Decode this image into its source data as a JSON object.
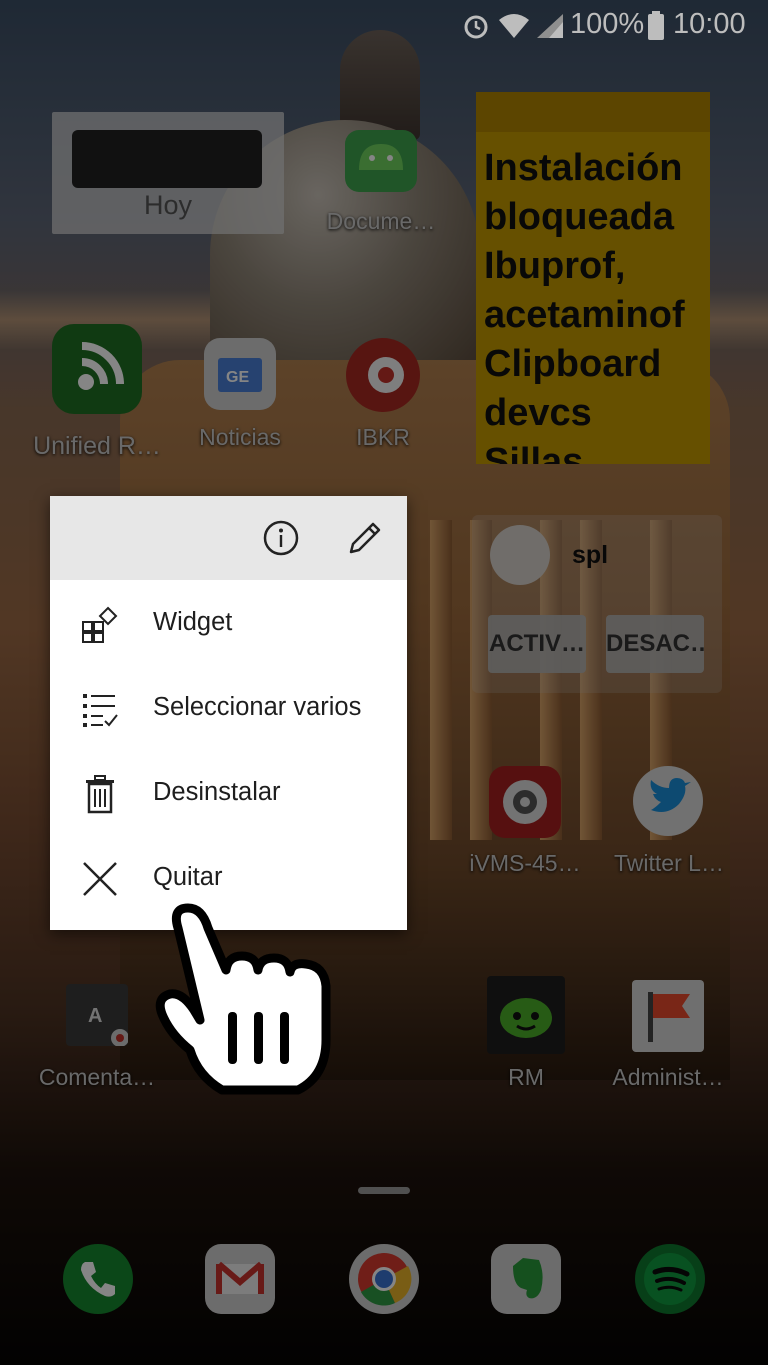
{
  "status_bar": {
    "battery_percent": "100%",
    "time": "10:00",
    "icons": [
      "alarm-icon",
      "wifi-icon",
      "signal-icon",
      "battery-icon"
    ]
  },
  "home": {
    "hoy_widget": {
      "label": "Hoy"
    },
    "sticky_note": {
      "text": "Instalación\nbloqueada\nIbuprof,\nacetaminof\nClipboard\ndevcs\nSillas"
    },
    "spl_widget": {
      "title": "spl",
      "buttons": [
        "ACTIV…",
        "DESAC…"
      ]
    },
    "apps": [
      {
        "label": "Docume…",
        "icon": "android-icon",
        "color": "#3fa34d"
      },
      {
        "label": "Unified R…",
        "icon": "remote-icon",
        "color": "#2e8b2e"
      },
      {
        "label": "Noticias",
        "icon": "news-icon",
        "color": "#e9e9e9"
      },
      {
        "label": "IBKR",
        "icon": "ibkr-icon",
        "color": "#d23a2e"
      },
      {
        "label": "iVMS-45…",
        "icon": "camera-icon",
        "color": "#c0282b"
      },
      {
        "label": "Twitter L…",
        "icon": "twitter-icon",
        "color": "#1da1f2"
      },
      {
        "label": "Comenta…",
        "icon": "document-icon",
        "color": "#555555"
      },
      {
        "label": "RM",
        "icon": "reddit-icon",
        "color": "#2a2a2a"
      },
      {
        "label": "Administ…",
        "icon": "flag-icon",
        "color": "#f25a3a"
      }
    ],
    "dock": [
      {
        "icon": "phone-icon",
        "color": "#24a84a"
      },
      {
        "icon": "gmail-icon",
        "color": "#d13b33"
      },
      {
        "icon": "chrome-icon",
        "color": "#d8d8d8"
      },
      {
        "icon": "evernote-icon",
        "color": "#d9d9d9"
      },
      {
        "icon": "spotify-icon",
        "color": "#1ed760"
      }
    ]
  },
  "context_menu": {
    "header_icons": [
      "info-icon",
      "edit-icon"
    ],
    "items": [
      {
        "label": "Widget",
        "icon": "widget-icon"
      },
      {
        "label": "Seleccionar varios",
        "icon": "select-multiple-icon"
      },
      {
        "label": "Desinstalar",
        "icon": "trash-icon"
      },
      {
        "label": "Quitar",
        "icon": "close-icon"
      }
    ]
  },
  "overlay": {
    "pointer": "hand-pointer-icon"
  }
}
